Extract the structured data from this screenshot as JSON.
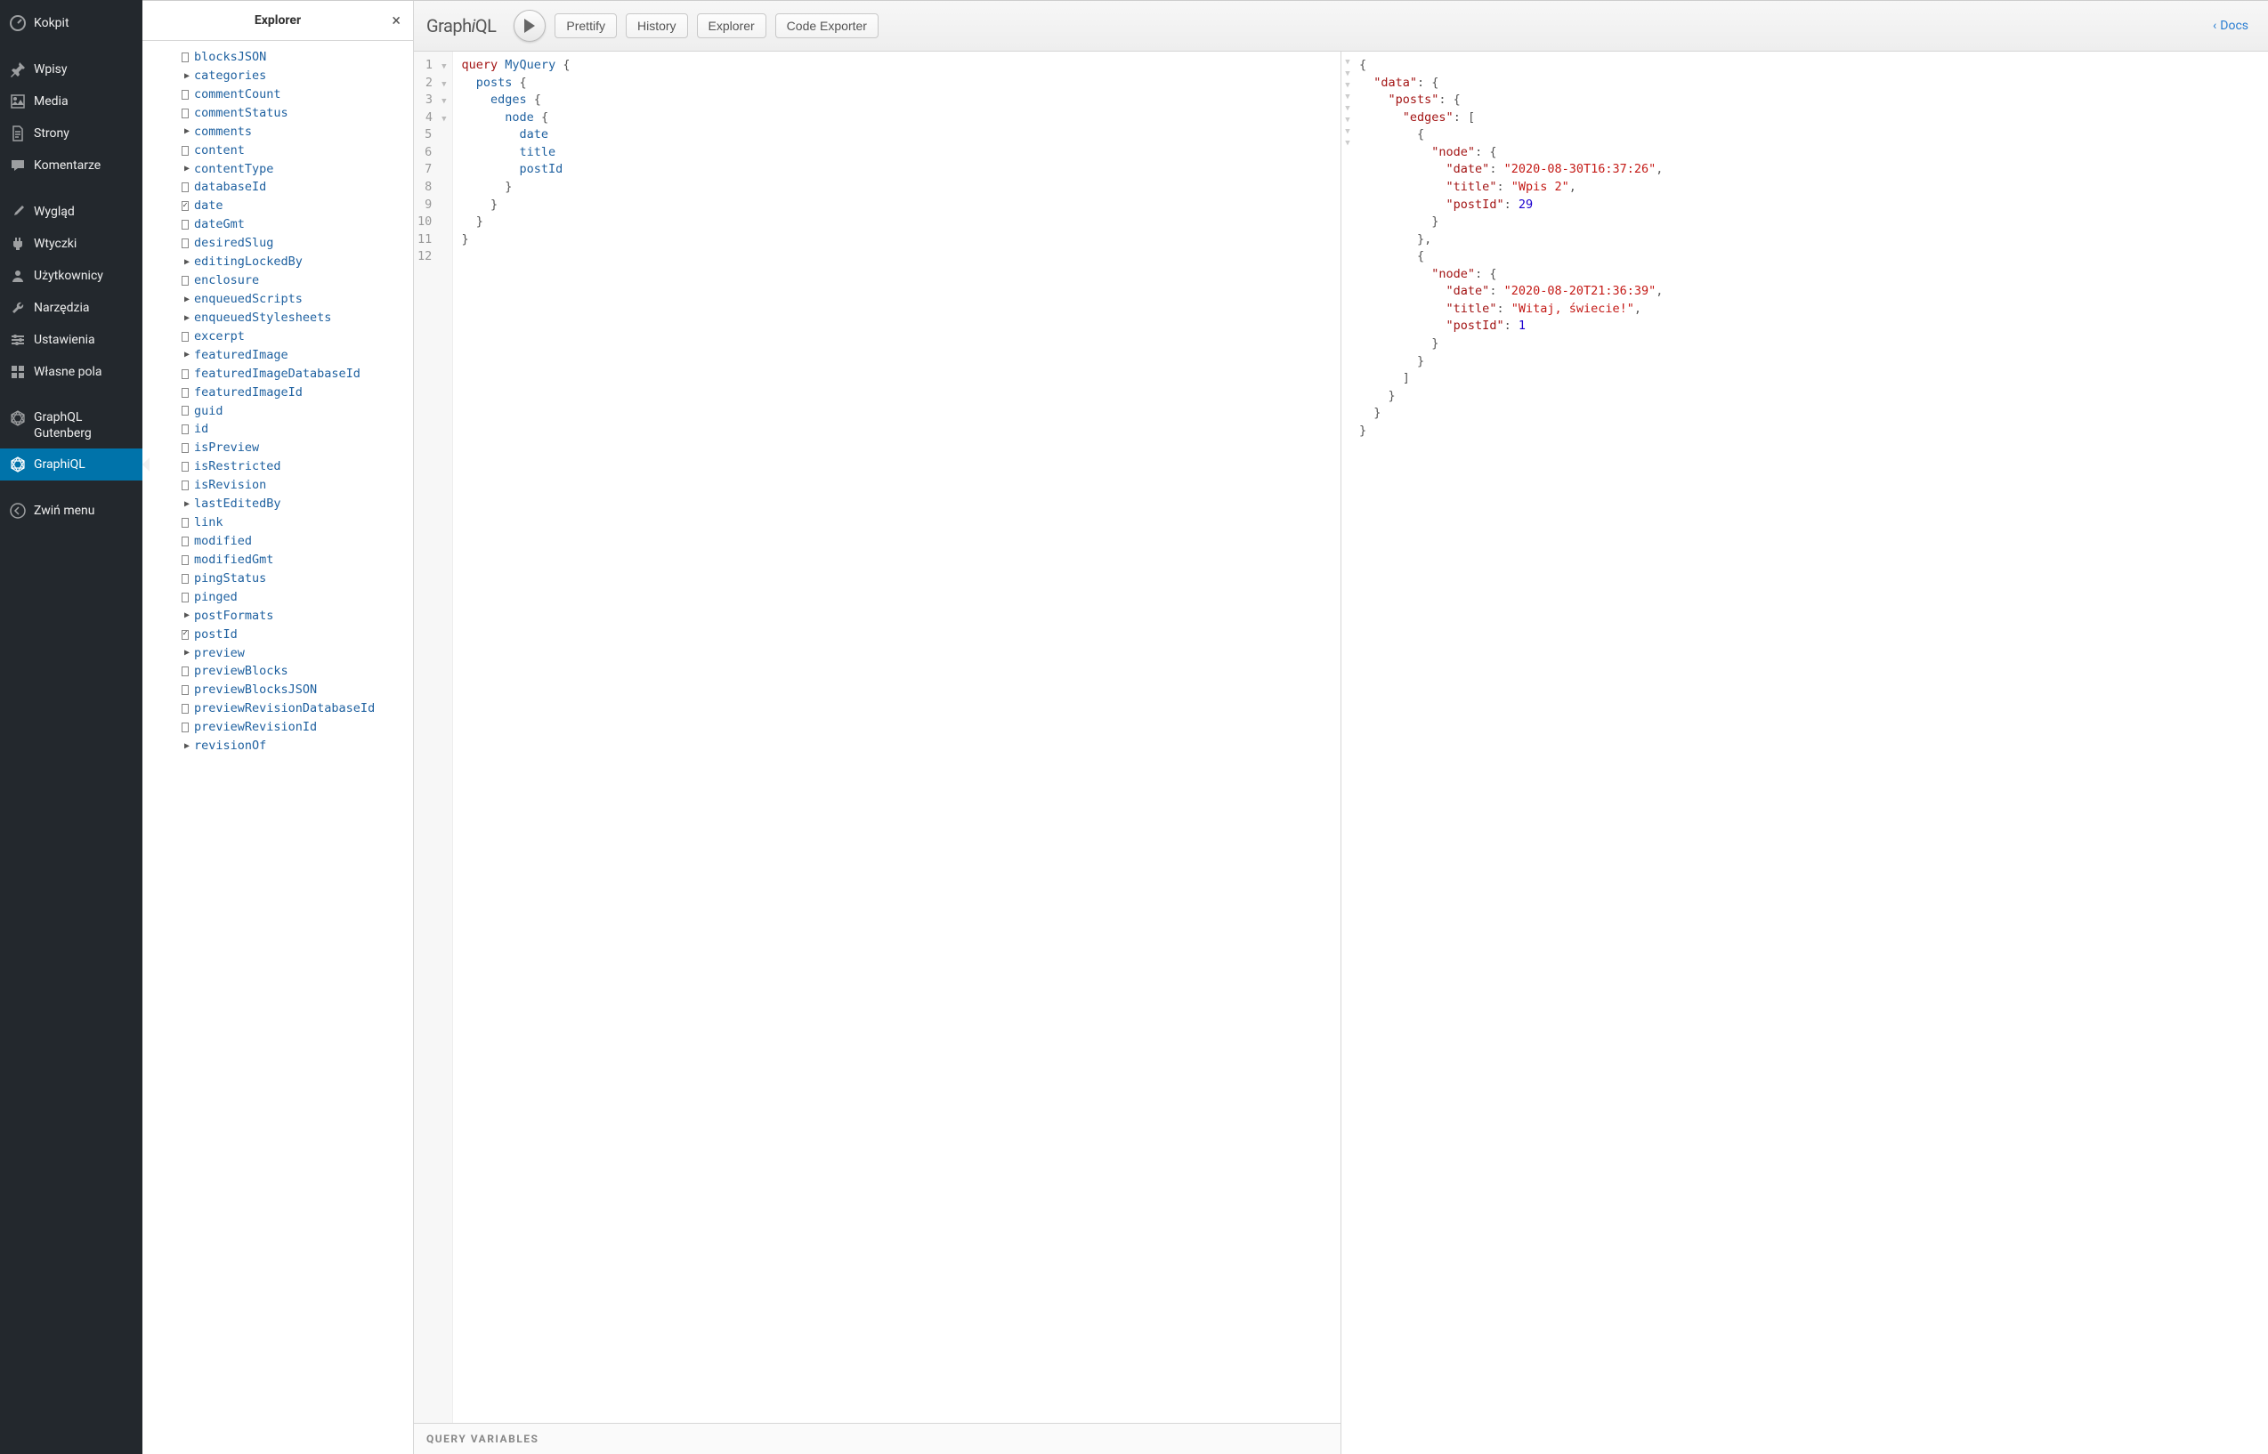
{
  "sidebar": {
    "items": [
      {
        "icon": "dashboard",
        "label": "Kokpit"
      },
      {
        "icon": "pin",
        "label": "Wpisy"
      },
      {
        "icon": "media",
        "label": "Media"
      },
      {
        "icon": "page",
        "label": "Strony"
      },
      {
        "icon": "comment",
        "label": "Komentarze"
      },
      {
        "icon": "brush",
        "label": "Wygląd"
      },
      {
        "icon": "plugin",
        "label": "Wtyczki"
      },
      {
        "icon": "user",
        "label": "Użytkownicy"
      },
      {
        "icon": "tool",
        "label": "Narzędzia"
      },
      {
        "icon": "settings",
        "label": "Ustawienia"
      },
      {
        "icon": "grid",
        "label": "Własne pola"
      },
      {
        "icon": "gql",
        "label": "GraphQL\nGutenberg"
      },
      {
        "icon": "gql",
        "label": "GraphiQL",
        "active": true
      },
      {
        "icon": "collapse",
        "label": "Zwiń menu"
      }
    ]
  },
  "explorer": {
    "title": "Explorer",
    "fields": [
      {
        "name": "blocksJSON",
        "type": "check",
        "checked": false
      },
      {
        "name": "categories",
        "type": "expand"
      },
      {
        "name": "commentCount",
        "type": "check",
        "checked": false
      },
      {
        "name": "commentStatus",
        "type": "check",
        "checked": false
      },
      {
        "name": "comments",
        "type": "expand"
      },
      {
        "name": "content",
        "type": "check",
        "checked": false
      },
      {
        "name": "contentType",
        "type": "expand"
      },
      {
        "name": "databaseId",
        "type": "check",
        "checked": false
      },
      {
        "name": "date",
        "type": "check",
        "checked": true
      },
      {
        "name": "dateGmt",
        "type": "check",
        "checked": false
      },
      {
        "name": "desiredSlug",
        "type": "check",
        "checked": false
      },
      {
        "name": "editingLockedBy",
        "type": "expand"
      },
      {
        "name": "enclosure",
        "type": "check",
        "checked": false
      },
      {
        "name": "enqueuedScripts",
        "type": "expand"
      },
      {
        "name": "enqueuedStylesheets",
        "type": "expand"
      },
      {
        "name": "excerpt",
        "type": "check",
        "checked": false
      },
      {
        "name": "featuredImage",
        "type": "expand"
      },
      {
        "name": "featuredImageDatabaseId",
        "type": "check",
        "checked": false
      },
      {
        "name": "featuredImageId",
        "type": "check",
        "checked": false
      },
      {
        "name": "guid",
        "type": "check",
        "checked": false
      },
      {
        "name": "id",
        "type": "check",
        "checked": false
      },
      {
        "name": "isPreview",
        "type": "check",
        "checked": false
      },
      {
        "name": "isRestricted",
        "type": "check",
        "checked": false
      },
      {
        "name": "isRevision",
        "type": "check",
        "checked": false
      },
      {
        "name": "lastEditedBy",
        "type": "expand"
      },
      {
        "name": "link",
        "type": "check",
        "checked": false
      },
      {
        "name": "modified",
        "type": "check",
        "checked": false
      },
      {
        "name": "modifiedGmt",
        "type": "check",
        "checked": false
      },
      {
        "name": "pingStatus",
        "type": "check",
        "checked": false
      },
      {
        "name": "pinged",
        "type": "check",
        "checked": false
      },
      {
        "name": "postFormats",
        "type": "expand"
      },
      {
        "name": "postId",
        "type": "check",
        "checked": true
      },
      {
        "name": "preview",
        "type": "expand"
      },
      {
        "name": "previewBlocks",
        "type": "check",
        "checked": false
      },
      {
        "name": "previewBlocksJSON",
        "type": "check",
        "checked": false
      },
      {
        "name": "previewRevisionDatabaseId",
        "type": "check",
        "checked": false
      },
      {
        "name": "previewRevisionId",
        "type": "check",
        "checked": false
      },
      {
        "name": "revisionOf",
        "type": "expand"
      }
    ]
  },
  "toolbar": {
    "logo": "GraphiQL",
    "prettify": "Prettify",
    "history": "History",
    "explorer": "Explorer",
    "code_exporter": "Code Exporter",
    "docs": "Docs"
  },
  "query": {
    "lines": [
      {
        "n": 1,
        "fold": true,
        "tokens": [
          {
            "t": "query ",
            "c": "kw"
          },
          {
            "t": "MyQuery",
            "c": "def"
          },
          {
            "t": " {",
            "c": "pn"
          }
        ]
      },
      {
        "n": 2,
        "fold": true,
        "tokens": [
          {
            "t": "  ",
            "c": ""
          },
          {
            "t": "posts",
            "c": "attr"
          },
          {
            "t": " {",
            "c": "pn"
          }
        ]
      },
      {
        "n": 3,
        "fold": true,
        "tokens": [
          {
            "t": "    ",
            "c": ""
          },
          {
            "t": "edges",
            "c": "attr"
          },
          {
            "t": " {",
            "c": "pn"
          }
        ]
      },
      {
        "n": 4,
        "fold": true,
        "tokens": [
          {
            "t": "      ",
            "c": ""
          },
          {
            "t": "node",
            "c": "attr"
          },
          {
            "t": " {",
            "c": "pn"
          }
        ]
      },
      {
        "n": 5,
        "fold": false,
        "tokens": [
          {
            "t": "        ",
            "c": ""
          },
          {
            "t": "date",
            "c": "attr"
          }
        ]
      },
      {
        "n": 6,
        "fold": false,
        "tokens": [
          {
            "t": "        ",
            "c": ""
          },
          {
            "t": "title",
            "c": "attr"
          }
        ]
      },
      {
        "n": 7,
        "fold": false,
        "tokens": [
          {
            "t": "        ",
            "c": ""
          },
          {
            "t": "postId",
            "c": "attr"
          }
        ]
      },
      {
        "n": 8,
        "fold": false,
        "tokens": [
          {
            "t": "      }",
            "c": "pn"
          }
        ]
      },
      {
        "n": 9,
        "fold": false,
        "tokens": [
          {
            "t": "    }",
            "c": "pn"
          }
        ]
      },
      {
        "n": 10,
        "fold": false,
        "tokens": [
          {
            "t": "  }",
            "c": "pn"
          }
        ]
      },
      {
        "n": 11,
        "fold": false,
        "tokens": [
          {
            "t": "}",
            "c": "pn"
          }
        ]
      },
      {
        "n": 12,
        "fold": false,
        "tokens": []
      }
    ],
    "variables_label": "Query Variables"
  },
  "result": {
    "data": {
      "posts": {
        "edges": [
          {
            "node": {
              "date": "2020-08-30T16:37:26",
              "title": "Wpis 2",
              "postId": 29
            }
          },
          {
            "node": {
              "date": "2020-08-20T21:36:39",
              "title": "Witaj, świecie!",
              "postId": 1
            }
          }
        ]
      }
    }
  }
}
